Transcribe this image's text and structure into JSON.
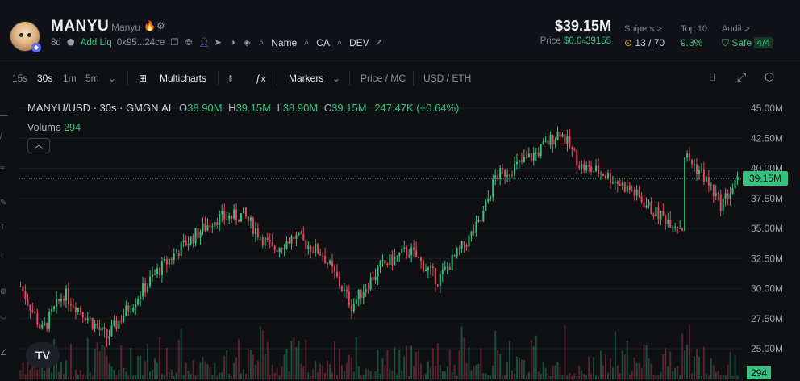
{
  "token": {
    "symbol": "MANYU",
    "name": "Manyu",
    "age": "8d",
    "add_liq": "Add Liq",
    "address": "0x95...24ce",
    "links": [
      "Name",
      "CA",
      "DEV"
    ]
  },
  "market": {
    "market_cap": "$39.15M",
    "price_label": "Price",
    "price_value": "$0.0₅39155"
  },
  "stats": {
    "snipers_label": "Snipers >",
    "snipers_value": "13 / 70",
    "top10_label": "Top 10",
    "top10_value": "9.3%",
    "audit_label": "Audit >",
    "audit_safe": "Safe",
    "audit_score": "4/4"
  },
  "toolbar": {
    "intervals": [
      "15s",
      "30s",
      "1m",
      "5m"
    ],
    "active_interval": "30s",
    "multicharts": "Multicharts",
    "markers": "Markers",
    "price_mc": "Price / MC",
    "price_mc_active": "MC",
    "usd_eth": "USD / ETH",
    "usd_eth_active": "USD"
  },
  "legend": {
    "pair": "MANYU/USD · 30s · GMGN.AI",
    "open_label": "O",
    "open": "38.90M",
    "high_label": "H",
    "high": "39.15M",
    "low_label": "L",
    "low": "38.90M",
    "close_label": "C",
    "close": "39.15M",
    "change": "247.47K (+0.64%)",
    "volume_label": "Volume",
    "volume_value": "294"
  },
  "colors": {
    "up": "#37c07e",
    "down": "#e5475d",
    "background": "#0e1014",
    "grid": "#1b1e24"
  },
  "chart_data": {
    "type": "candlestick",
    "title": "MANYU/USD · 30s · GMGN.AI",
    "yaxis_ticks": [
      "45.00M",
      "42.50M",
      "40.00M",
      "37.50M",
      "35.00M",
      "32.50M",
      "30.00M",
      "27.50M",
      "25.00M"
    ],
    "ylim": [
      24.0,
      45.5
    ],
    "y_units": "M USD",
    "current_value": 39.15,
    "current_label": "39.15M",
    "volume_current": "294",
    "close_path_x": [
      0,
      3,
      6,
      9,
      12,
      15,
      19,
      23,
      27,
      31,
      35,
      38,
      42,
      46,
      50,
      54,
      58,
      62,
      64,
      66,
      69,
      72,
      75,
      78,
      81,
      85,
      88,
      92,
      96,
      100
    ],
    "close_path_y": [
      30.2,
      26.5,
      29.6,
      27.8,
      25.9,
      28.4,
      31.4,
      33.8,
      35.8,
      36.1,
      33.2,
      34.3,
      32.9,
      28.6,
      31.8,
      33.2,
      30.7,
      33.9,
      35.6,
      39.3,
      40.2,
      41.4,
      43.1,
      40.1,
      39.6,
      38.1,
      36.4,
      35.1,
      38.3,
      42.7
    ],
    "end_segment_y": [
      41.3,
      39.6,
      37.0,
      39.15
    ]
  }
}
